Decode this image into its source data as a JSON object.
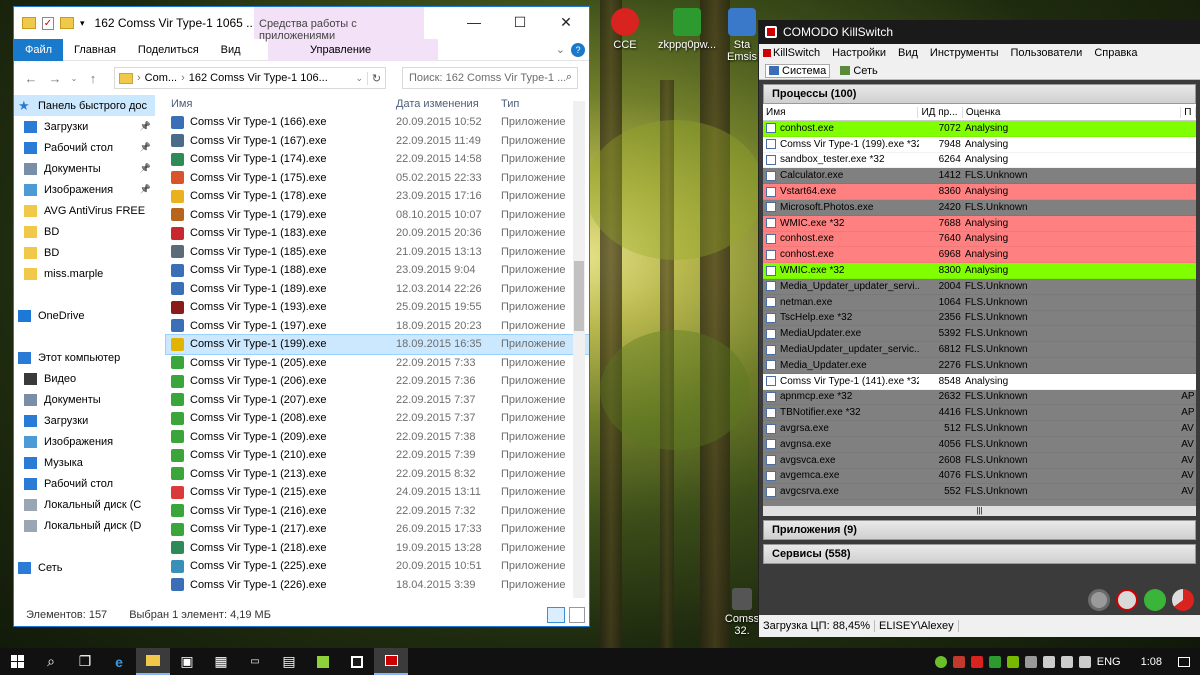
{
  "desktop": {
    "icons": [
      {
        "label": "CCE",
        "color": "#d9231f"
      },
      {
        "label": "zkppq0pw...",
        "color": "#2d9a2f"
      },
      {
        "label": "Sta Emsis",
        "color": "#3a78c9"
      },
      {
        "label": "Comss 32.",
        "color": "#555555"
      }
    ]
  },
  "explorer": {
    "title": "162 Comss Vir Type-1 1065 ...",
    "context_title": "Средства работы с приложениями",
    "window_buttons": {
      "minimize": "—",
      "maximize": "☐",
      "close": "✕"
    },
    "ribbon": {
      "tabs": [
        "Файл",
        "Главная",
        "Поделиться",
        "Вид"
      ],
      "context_tab": "Управление",
      "help": "?"
    },
    "path": [
      "Com...",
      "162 Comss Vir Type-1 106..."
    ],
    "search_placeholder": "Поиск: 162 Comss Vir Type-1 ...",
    "nav": [
      {
        "label": "Панель быстрого дос",
        "icon": "star-icon",
        "selected": true,
        "pinned": false,
        "color": "#2a7bd6"
      },
      {
        "label": "Загрузки",
        "icon": "download-icon",
        "pinned": true,
        "color": "#2a7bd6"
      },
      {
        "label": "Рабочий стол",
        "icon": "desktop-icon",
        "pinned": true,
        "color": "#2a7bd6"
      },
      {
        "label": "Документы",
        "icon": "document-icon",
        "pinned": true,
        "color": "#7a8ea8"
      },
      {
        "label": "Изображения",
        "icon": "pictures-icon",
        "pinned": true,
        "color": "#4c9bd6"
      },
      {
        "label": "AVG AntiVirus FREE",
        "icon": "folder-icon",
        "pinned": false,
        "color": "#f0c84a"
      },
      {
        "label": "BD",
        "icon": "folder-icon",
        "pinned": false,
        "color": "#f0c84a"
      },
      {
        "label": "BD",
        "icon": "folder-icon",
        "pinned": false,
        "color": "#f0c84a"
      },
      {
        "label": "miss.marple",
        "icon": "folder-icon",
        "pinned": false,
        "color": "#f0c84a"
      },
      {
        "label": "",
        "icon": "",
        "pinned": false,
        "color": ""
      },
      {
        "label": "OneDrive",
        "icon": "cloud-icon",
        "pinned": false,
        "color": "#1e78d7"
      },
      {
        "label": "",
        "icon": "",
        "pinned": false,
        "color": ""
      },
      {
        "label": "Этот компьютер",
        "icon": "computer-icon",
        "pinned": false,
        "color": "#2a7bd6"
      },
      {
        "label": "Видео",
        "icon": "video-icon",
        "pinned": false,
        "color": "#3a3a3a"
      },
      {
        "label": "Документы",
        "icon": "document-icon",
        "pinned": false,
        "color": "#7a8ea8"
      },
      {
        "label": "Загрузки",
        "icon": "download-icon",
        "pinned": false,
        "color": "#2a7bd6"
      },
      {
        "label": "Изображения",
        "icon": "pictures-icon",
        "pinned": false,
        "color": "#4c9bd6"
      },
      {
        "label": "Музыка",
        "icon": "music-icon",
        "pinned": false,
        "color": "#2a7bd6"
      },
      {
        "label": "Рабочий стол",
        "icon": "desktop-icon",
        "pinned": false,
        "color": "#2a7bd6"
      },
      {
        "label": "Локальный диск (C",
        "icon": "drive-icon",
        "pinned": false,
        "color": "#9aa6b4"
      },
      {
        "label": "Локальный диск (D",
        "icon": "drive-icon",
        "pinned": false,
        "color": "#9aa6b4"
      },
      {
        "label": "",
        "icon": "",
        "pinned": false,
        "color": ""
      },
      {
        "label": "Сеть",
        "icon": "network-icon",
        "pinned": false,
        "color": "#2a7bd6"
      }
    ],
    "columns": [
      "Имя",
      "Дата изменения",
      "Тип"
    ],
    "files": [
      {
        "name": "Comss Vir Type-1  (166).exe",
        "date": "20.09.2015 10:52",
        "type": "Приложение",
        "color": "#3a6fb8"
      },
      {
        "name": "Comss Vir Type-1  (167).exe",
        "date": "22.09.2015 11:49",
        "type": "Приложение",
        "color": "#4b6b8a"
      },
      {
        "name": "Comss Vir Type-1  (174).exe",
        "date": "22.09.2015 14:58",
        "type": "Приложение",
        "color": "#2e8b57"
      },
      {
        "name": "Comss Vir Type-1  (175).exe",
        "date": "05.02.2015 22:33",
        "type": "Приложение",
        "color": "#d9542b"
      },
      {
        "name": "Comss Vir Type-1  (178).exe",
        "date": "23.09.2015 17:16",
        "type": "Приложение",
        "color": "#e8b11d"
      },
      {
        "name": "Comss Vir Type-1  (179).exe",
        "date": "08.10.2015 10:07",
        "type": "Приложение",
        "color": "#b5651d"
      },
      {
        "name": "Comss Vir Type-1  (183).exe",
        "date": "20.09.2015 20:36",
        "type": "Приложение",
        "color": "#c8272d"
      },
      {
        "name": "Comss Vir Type-1  (185).exe",
        "date": "21.09.2015 13:13",
        "type": "Приложение",
        "color": "#5a6b7a"
      },
      {
        "name": "Comss Vir Type-1  (188).exe",
        "date": "23.09.2015 9:04",
        "type": "Приложение",
        "color": "#3a6fb8"
      },
      {
        "name": "Comss Vir Type-1  (189).exe",
        "date": "12.03.2014 22:26",
        "type": "Приложение",
        "color": "#3a6fb8"
      },
      {
        "name": "Comss Vir Type-1  (193).exe",
        "date": "25.09.2015 19:55",
        "type": "Приложение",
        "color": "#8b1a1a"
      },
      {
        "name": "Comss Vir Type-1  (197).exe",
        "date": "18.09.2015 20:23",
        "type": "Приложение",
        "color": "#3a6fb8"
      },
      {
        "name": "Comss Vir Type-1  (199).exe",
        "date": "18.09.2015 16:35",
        "type": "Приложение",
        "color": "#e0b400",
        "selected": true
      },
      {
        "name": "Comss Vir Type-1  (205).exe",
        "date": "22.09.2015 7:33",
        "type": "Приложение",
        "color": "#3aa53a"
      },
      {
        "name": "Comss Vir Type-1  (206).exe",
        "date": "22.09.2015 7:36",
        "type": "Приложение",
        "color": "#3aa53a"
      },
      {
        "name": "Comss Vir Type-1  (207).exe",
        "date": "22.09.2015 7:37",
        "type": "Приложение",
        "color": "#3aa53a"
      },
      {
        "name": "Comss Vir Type-1  (208).exe",
        "date": "22.09.2015 7:37",
        "type": "Приложение",
        "color": "#3aa53a"
      },
      {
        "name": "Comss Vir Type-1  (209).exe",
        "date": "22.09.2015 7:38",
        "type": "Приложение",
        "color": "#3aa53a"
      },
      {
        "name": "Comss Vir Type-1  (210).exe",
        "date": "22.09.2015 7:39",
        "type": "Приложение",
        "color": "#3aa53a"
      },
      {
        "name": "Comss Vir Type-1  (213).exe",
        "date": "22.09.2015 8:32",
        "type": "Приложение",
        "color": "#3aa53a"
      },
      {
        "name": "Comss Vir Type-1  (215).exe",
        "date": "24.09.2015 13:11",
        "type": "Приложение",
        "color": "#d93a3a"
      },
      {
        "name": "Comss Vir Type-1  (216).exe",
        "date": "22.09.2015 7:32",
        "type": "Приложение",
        "color": "#3aa53a"
      },
      {
        "name": "Comss Vir Type-1  (217).exe",
        "date": "26.09.2015 17:33",
        "type": "Приложение",
        "color": "#3aa53a"
      },
      {
        "name": "Comss Vir Type-1  (218).exe",
        "date": "19.09.2015 13:28",
        "type": "Приложение",
        "color": "#2e8b57"
      },
      {
        "name": "Comss Vir Type-1  (225).exe",
        "date": "20.09.2015 10:51",
        "type": "Приложение",
        "color": "#3a8fb8"
      },
      {
        "name": "Comss Vir Type-1  (226).exe",
        "date": "18.04.2015 3:39",
        "type": "Приложение",
        "color": "#3a6fb8"
      }
    ],
    "status_items": "Элементов: 157",
    "status_selected": "Выбран 1 элемент: 4,19 МБ"
  },
  "killswitch": {
    "title": "COMODO KillSwitch",
    "menu": [
      "KillSwitch",
      "Настройки",
      "Вид",
      "Инструменты",
      "Пользователи",
      "Справка"
    ],
    "tabs": [
      "Система",
      "Сеть"
    ],
    "processes_header": "Процессы (100)",
    "columns": [
      "Имя",
      "ИД пр...",
      "Оценка",
      "П"
    ],
    "rows": [
      {
        "name": "conhost.exe",
        "pid": "7072",
        "rating": "Analysing",
        "extra": "",
        "bg": "#80ff00"
      },
      {
        "name": "Comss Vir Type-1  (199).exe *32",
        "pid": "7948",
        "rating": "Analysing",
        "extra": "",
        "bg": "#ffffff"
      },
      {
        "name": "sandbox_tester.exe *32",
        "pid": "6264",
        "rating": "Analysing",
        "extra": "",
        "bg": "#ffffff"
      },
      {
        "name": "Calculator.exe",
        "pid": "1412",
        "rating": "FLS.Unknown",
        "extra": "",
        "bg": "#808080"
      },
      {
        "name": "Vstart64.exe",
        "pid": "8360",
        "rating": "Analysing",
        "extra": "",
        "bg": "#ff8080"
      },
      {
        "name": "Microsoft.Photos.exe",
        "pid": "2420",
        "rating": "FLS.Unknown",
        "extra": "",
        "bg": "#808080"
      },
      {
        "name": "WMIC.exe *32",
        "pid": "7688",
        "rating": "Analysing",
        "extra": "",
        "bg": "#ff8080"
      },
      {
        "name": "conhost.exe",
        "pid": "7640",
        "rating": "Analysing",
        "extra": "",
        "bg": "#ff8080"
      },
      {
        "name": "conhost.exe",
        "pid": "6968",
        "rating": "Analysing",
        "extra": "",
        "bg": "#ff8080"
      },
      {
        "name": "WMIC.exe *32",
        "pid": "8300",
        "rating": "Analysing",
        "extra": "",
        "bg": "#80ff00"
      },
      {
        "name": "Media_Updater_updater_servi...",
        "pid": "2004",
        "rating": "FLS.Unknown",
        "extra": "",
        "bg": "#808080"
      },
      {
        "name": "netman.exe",
        "pid": "1064",
        "rating": "FLS.Unknown",
        "extra": "",
        "bg": "#808080"
      },
      {
        "name": "TscHelp.exe *32",
        "pid": "2356",
        "rating": "FLS.Unknown",
        "extra": "",
        "bg": "#808080"
      },
      {
        "name": "MediaUpdater.exe",
        "pid": "5392",
        "rating": "FLS.Unknown",
        "extra": "",
        "bg": "#808080"
      },
      {
        "name": "MediaUpdater_updater_servic...",
        "pid": "6812",
        "rating": "FLS.Unknown",
        "extra": "",
        "bg": "#808080"
      },
      {
        "name": "Media_Updater.exe",
        "pid": "2276",
        "rating": "FLS.Unknown",
        "extra": "",
        "bg": "#808080"
      },
      {
        "name": "Comss Vir Type-1  (141).exe *32",
        "pid": "8548",
        "rating": "Analysing",
        "extra": "",
        "bg": "#ffffff"
      },
      {
        "name": "apnmcp.exe *32",
        "pid": "2632",
        "rating": "FLS.Unknown",
        "extra": "AP",
        "bg": "#808080"
      },
      {
        "name": "TBNotifier.exe *32",
        "pid": "4416",
        "rating": "FLS.Unknown",
        "extra": "AP",
        "bg": "#808080"
      },
      {
        "name": "avgrsa.exe",
        "pid": "512",
        "rating": "FLS.Unknown",
        "extra": "AV",
        "bg": "#808080"
      },
      {
        "name": "avgnsa.exe",
        "pid": "4056",
        "rating": "FLS.Unknown",
        "extra": "AV",
        "bg": "#808080"
      },
      {
        "name": "avgsvca.exe",
        "pid": "2608",
        "rating": "FLS.Unknown",
        "extra": "AV",
        "bg": "#808080"
      },
      {
        "name": "avgemca.exe",
        "pid": "4076",
        "rating": "FLS.Unknown",
        "extra": "AV",
        "bg": "#808080"
      },
      {
        "name": "avgcsrva.exe",
        "pid": "552",
        "rating": "FLS.Unknown",
        "extra": "AV",
        "bg": "#808080"
      }
    ],
    "apps_header": "Приложения (9)",
    "services_header": "Сервисы (558)",
    "footer_cpu": "Загрузка ЦП: 88,45%",
    "footer_user": "ELISEY\\Alexey"
  },
  "taskbar": {
    "lang": "ENG",
    "time": "1:08"
  }
}
